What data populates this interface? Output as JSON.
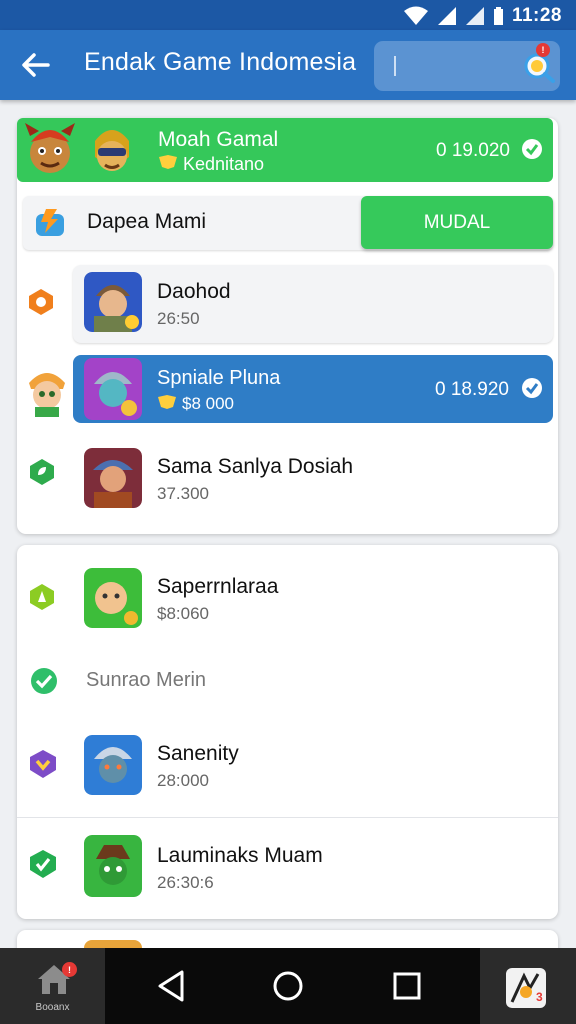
{
  "status_bar": {
    "time": "11:28",
    "signal_icons": [
      "wifi-icon",
      "signal-icon",
      "signal-icon",
      "battery-icon"
    ]
  },
  "app_bar": {
    "title": "Endak Game Indomesia",
    "back_icon": "arrow-left-icon",
    "search_value": "",
    "search_icon": "search-icon",
    "search_badge": "!"
  },
  "colors": {
    "app_bar": "#2a72c2",
    "status_bar": "#1c58a5",
    "green": "#34c759",
    "blue_highlight": "#2f7dc6",
    "nav_bar": "#0a0a0a"
  },
  "featured": {
    "name": "Moah Gamal",
    "sub": "Kednitano",
    "amount": "0 19.020"
  },
  "dapea_row": {
    "name": "Dapea Mami",
    "button_label": "MUDAL"
  },
  "list_one": [
    {
      "name": "Daohod",
      "sub": "26:50"
    },
    {
      "name": "Spniale Pluna",
      "sub": "$8 000",
      "amount": "0 18.920",
      "highlighted": true
    },
    {
      "name": "Sama Sanlya Dosiah",
      "sub": "37.300"
    }
  ],
  "list_two": [
    {
      "name": "Saperrnlaraa",
      "sub": "$8:060"
    },
    {
      "name": "Sunrao Merin"
    },
    {
      "name": "Sanenity",
      "sub": "28:000"
    },
    {
      "name": "Lauminaks Muam",
      "sub": "26:30:6"
    }
  ],
  "bottom_nav": {
    "home_label": "Booanx",
    "home_badge": "!",
    "extra_badge": "3"
  }
}
